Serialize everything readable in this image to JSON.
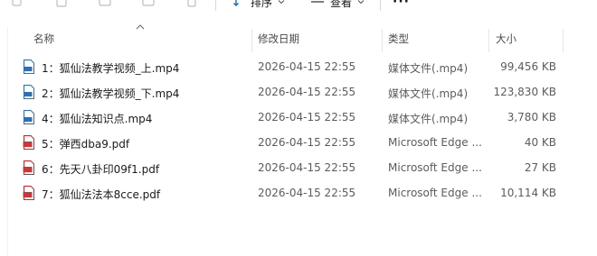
{
  "toolbar": {
    "sort_label": "排序",
    "view_label": "查看",
    "more_label": "···"
  },
  "columns": {
    "name": "名称",
    "date": "修改日期",
    "type": "类型",
    "size": "大小"
  },
  "files": [
    {
      "name": "1：狐仙法教学视频_上.mp4",
      "date": "2026-04-15 22:55",
      "type": "媒体文件(.mp4)",
      "size": "99,456 KB",
      "icon": "mp4-file-icon"
    },
    {
      "name": "2：狐仙法教学视频_下.mp4",
      "date": "2026-04-15 22:55",
      "type": "媒体文件(.mp4)",
      "size": "123,830 KB",
      "icon": "mp4-file-icon"
    },
    {
      "name": "4：狐仙法知识点.mp4",
      "date": "2026-04-15 22:55",
      "type": "媒体文件(.mp4)",
      "size": "3,780 KB",
      "icon": "mp4-file-icon"
    },
    {
      "name": "5：弹西dba9.pdf",
      "date": "2026-04-15 22:55",
      "type": "Microsoft Edge ...",
      "size": "40 KB",
      "icon": "pdf-file-icon"
    },
    {
      "name": "6：先天八卦印09f1.pdf",
      "date": "2026-04-15 22:55",
      "type": "Microsoft Edge ...",
      "size": "27 KB",
      "icon": "pdf-file-icon"
    },
    {
      "name": "7：狐仙法法本8cce.pdf",
      "date": "2026-04-15 22:55",
      "type": "Microsoft Edge ...",
      "size": "10,114 KB",
      "icon": "pdf-file-icon"
    }
  ]
}
